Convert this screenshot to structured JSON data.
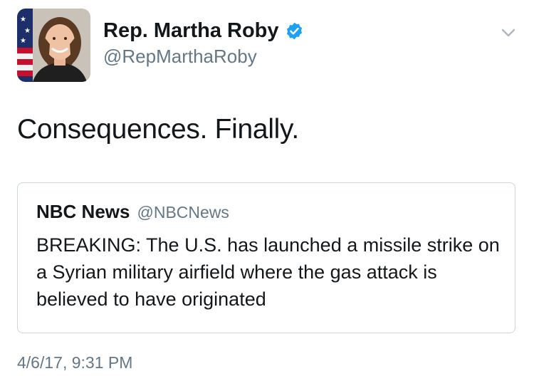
{
  "author": {
    "display_name": "Rep. Martha Roby",
    "handle": "@RepMarthaRoby",
    "avatar": "profile-photo",
    "verified_icon": "verified-badge-icon",
    "verified_color": "#1da1f2"
  },
  "menu": {
    "icon": "chevron-down-icon",
    "color": "#aab8c2"
  },
  "tweet": {
    "text": "Consequences. Finally.",
    "timestamp": "4/6/17, 9:31 PM"
  },
  "quoted_tweet": {
    "display_name": "NBC News",
    "handle": "@NBCNews",
    "text": "BREAKING: The U.S. has launched a missile strike on a Syrian military airfield where the gas attack is believed to have originated",
    "border_color": "#ccd6dd"
  }
}
